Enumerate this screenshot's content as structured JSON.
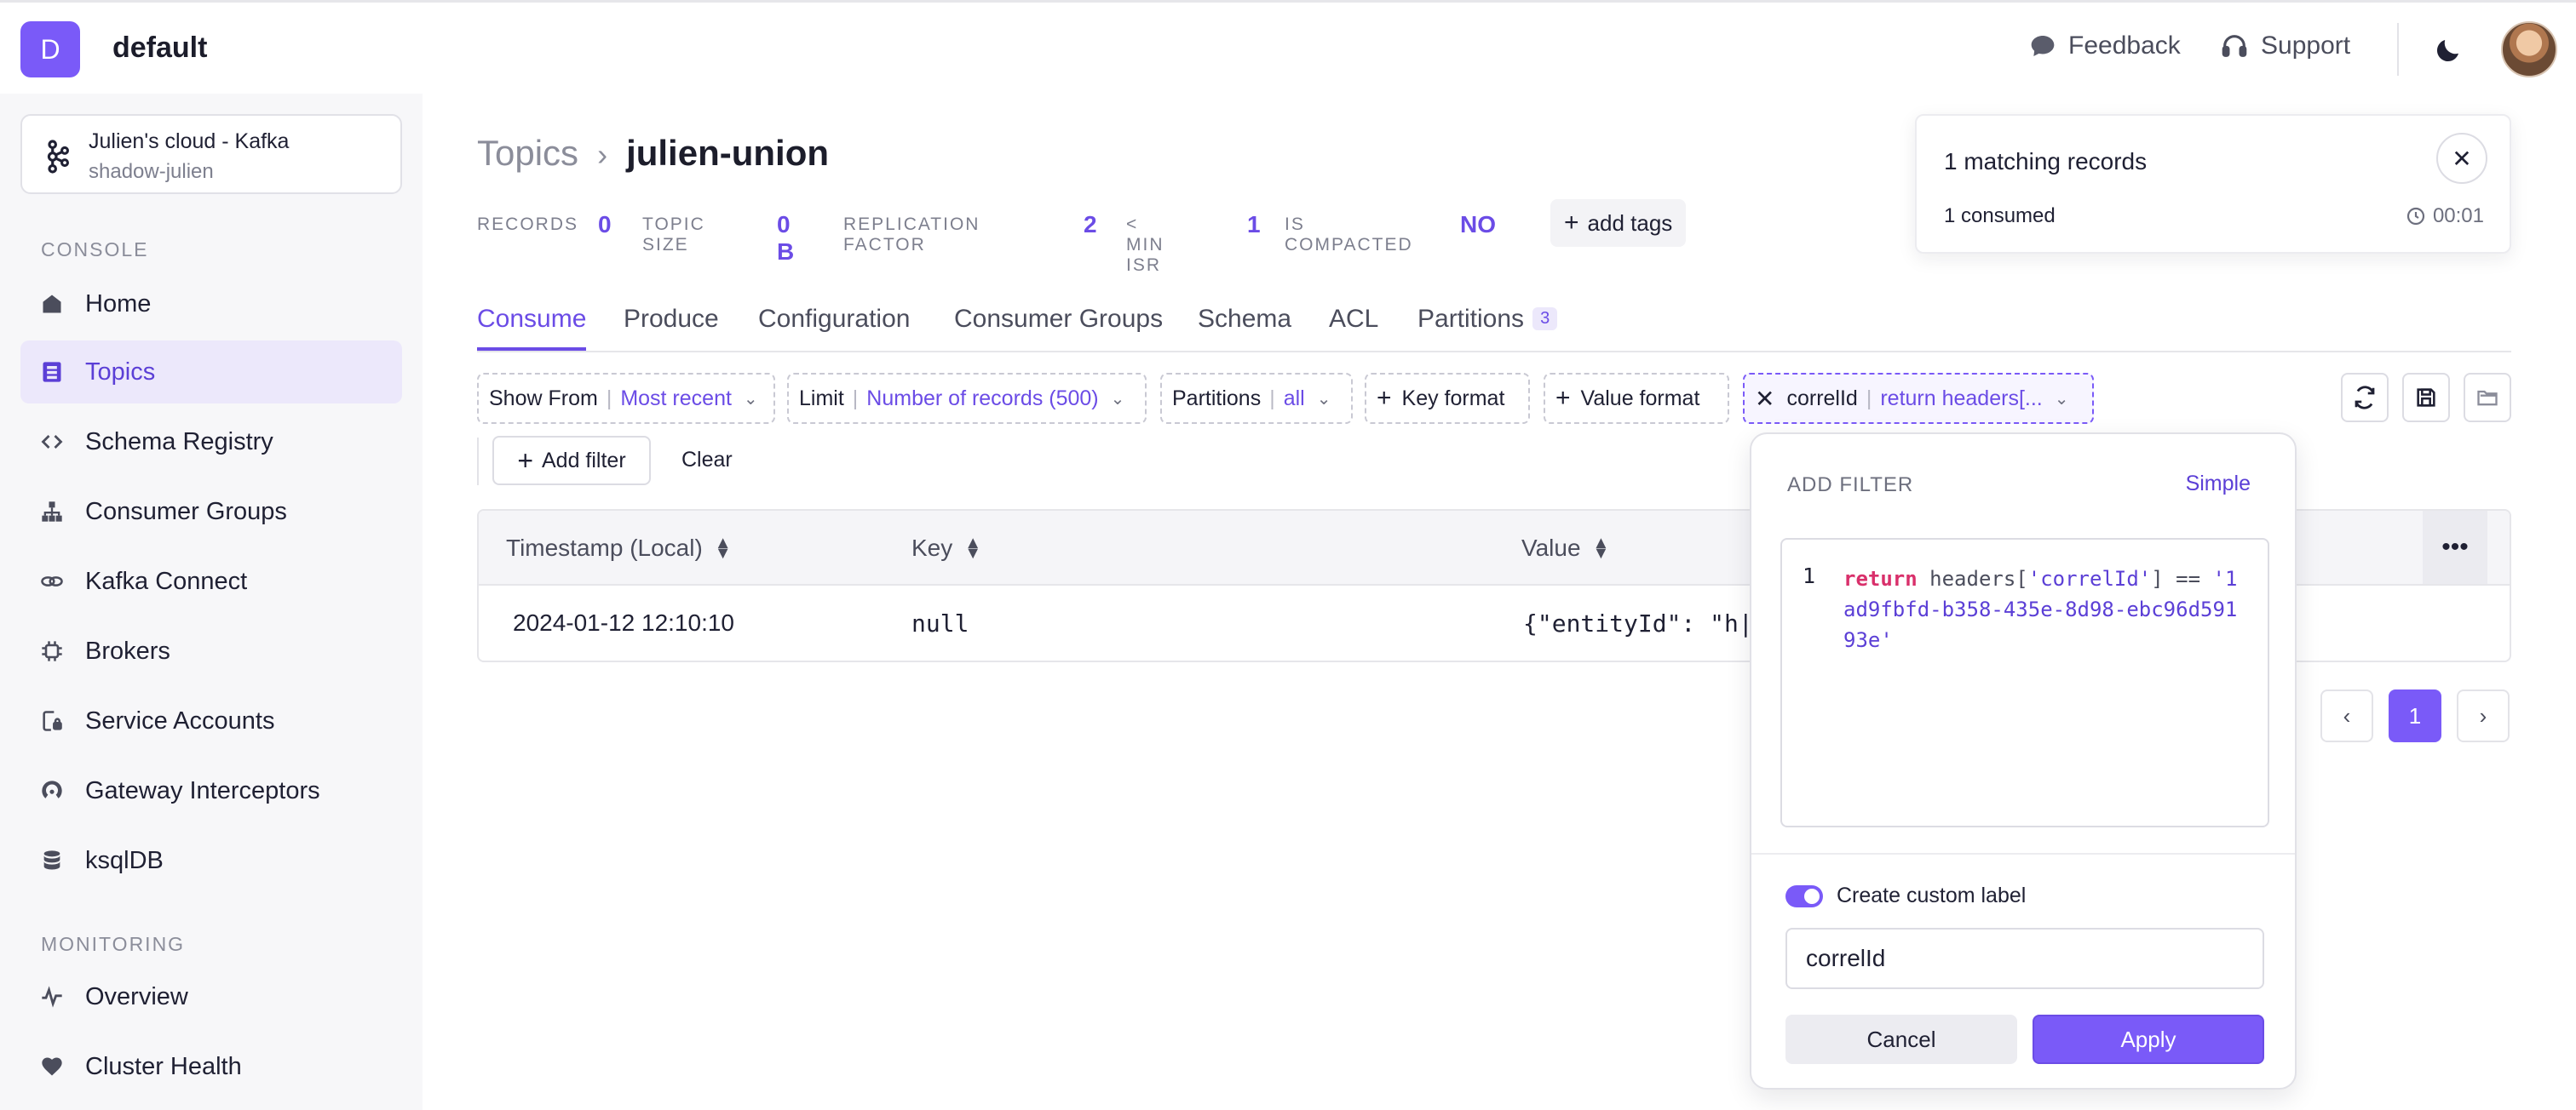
{
  "header": {
    "org_initial": "D",
    "org_name": "default",
    "feedback_label": "Feedback",
    "support_label": "Support"
  },
  "sidebar": {
    "cluster_name": "Julien's cloud - Kafka",
    "cluster_sub": "shadow-julien",
    "console_label": "CONSOLE",
    "items": [
      {
        "label": "Home",
        "icon": "home-icon"
      },
      {
        "label": "Topics",
        "icon": "topics-icon",
        "active": true
      },
      {
        "label": "Schema Registry",
        "icon": "code-icon"
      },
      {
        "label": "Consumer Groups",
        "icon": "hierarchy-icon"
      },
      {
        "label": "Kafka Connect",
        "icon": "link-icon"
      },
      {
        "label": "Brokers",
        "icon": "chip-icon"
      },
      {
        "label": "Service Accounts",
        "icon": "lock-file-icon"
      },
      {
        "label": "Gateway Interceptors",
        "icon": "gateway-icon"
      },
      {
        "label": "ksqlDB",
        "icon": "database-icon"
      }
    ],
    "monitoring_label": "MONITORING",
    "monitoring_items": [
      {
        "label": "Overview",
        "icon": "pulse-icon"
      },
      {
        "label": "Cluster Health",
        "icon": "heart-icon"
      }
    ]
  },
  "breadcrumb": {
    "parent": "Topics",
    "current": "julien-union"
  },
  "stats": {
    "records_label": "RECORDS",
    "records_value": "0",
    "topic_size_label": "TOPIC SIZE",
    "topic_size_value": "0 B",
    "replication_label": "REPLICATION FACTOR",
    "replication_value": "2",
    "min_isr_label": "< MIN ISR",
    "min_isr_value": "1",
    "compacted_label": "IS COMPACTED",
    "compacted_value": "NO",
    "add_tags_label": "add tags"
  },
  "tabs": {
    "consume": "Consume",
    "produce": "Produce",
    "configuration": "Configuration",
    "consumer_groups": "Consumer Groups",
    "schema": "Schema",
    "acl": "ACL",
    "partitions": "Partitions",
    "partitions_count": "3"
  },
  "filters": {
    "show_from_label": "Show From",
    "show_from_value": "Most recent",
    "limit_label": "Limit",
    "limit_value": "Number of records (500)",
    "partitions_label": "Partitions",
    "partitions_value": "all",
    "key_format_label": "Key format",
    "value_format_label": "Value format",
    "custom_label": "correlId",
    "custom_value": "return headers[...",
    "add_filter_label": "Add filter",
    "clear_label": "Clear"
  },
  "table": {
    "columns": [
      "Timestamp (Local)",
      "Key",
      "Value"
    ],
    "rows": [
      {
        "timestamp": "2024-01-12 12:10:10",
        "key": "null",
        "value": "{\"entityId\": \"h|"
      }
    ]
  },
  "pagination": {
    "current_page": "1"
  },
  "toast": {
    "title": "1 matching records",
    "consumed": "1 consumed",
    "elapsed": "00:01"
  },
  "filter_popover": {
    "title": "ADD FILTER",
    "mode_link": "Simple",
    "line_number": "1",
    "code_keyword": "return",
    "code_mid": " headers[",
    "code_key": "'correlId'",
    "code_op": "] == ",
    "code_value": "'1ad9fbfd-b358-435e-8d98-ebc96d59193e'",
    "toggle_label": "Create custom label",
    "toggle_on": true,
    "label_value": "correlId",
    "cancel_label": "Cancel",
    "apply_label": "Apply"
  },
  "colors": {
    "accent": "#7a5af8",
    "accent_text": "#6b4ce6",
    "keyword": "#d9306b"
  }
}
